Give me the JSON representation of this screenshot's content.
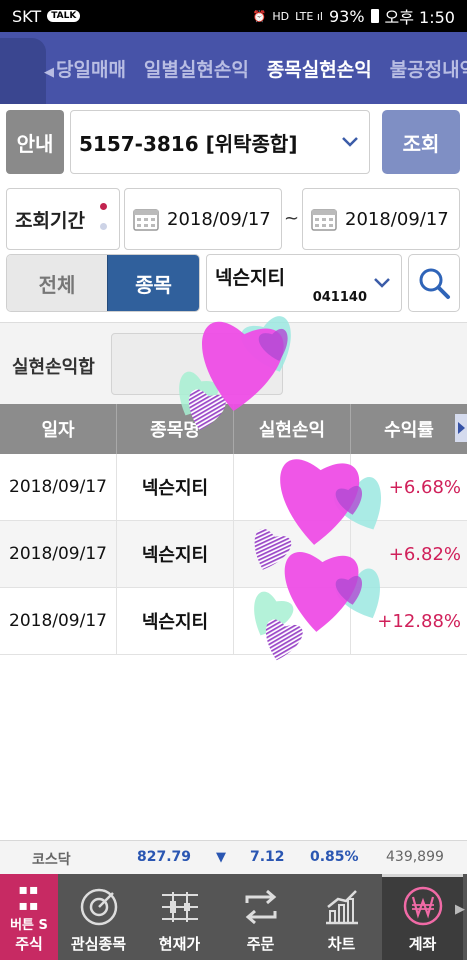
{
  "status_bar": {
    "carrier": "SKT",
    "badge": "TALK",
    "battery": "93%",
    "time": "오후 1:50"
  },
  "tabs": [
    {
      "label": "당일매매"
    },
    {
      "label": "일별실현손익"
    },
    {
      "label": "종목실현손익",
      "active": true
    },
    {
      "label": "불공정내역"
    }
  ],
  "account": {
    "guide_button": "안내",
    "value": "5157-3816 [위탁종합]",
    "query_button": "조회"
  },
  "period": {
    "label": "조회기간",
    "start": "2018/09/17",
    "separator": "~",
    "end": "2018/09/17"
  },
  "filter": {
    "all_label": "전체",
    "item_label": "종목",
    "selected_item": "종목"
  },
  "stock": {
    "name": "넥슨지티",
    "code": "041140"
  },
  "summary": {
    "label": "실현손익합"
  },
  "table": {
    "headers": [
      "일자",
      "종목명",
      "실현손익",
      "수익률"
    ],
    "rows": [
      {
        "date": "2018/09/17",
        "name": "넥슨지티",
        "profit": "",
        "rate": "+6.68%"
      },
      {
        "date": "2018/09/17",
        "name": "넥슨지티",
        "profit": "",
        "rate": "+6.82%"
      },
      {
        "date": "2018/09/17",
        "name": "넥슨지티",
        "profit": "",
        "rate": "+12.88%"
      }
    ]
  },
  "ticker": {
    "name": "코스닥",
    "value": "827.79",
    "direction": "▼",
    "change": "7.12",
    "percent": "0.85%",
    "volume": "439,899"
  },
  "nav": {
    "brand": "버튼 S",
    "items": [
      "주식",
      "관심종목",
      "현재가",
      "주문",
      "차트",
      "계좌"
    ],
    "active": "계좌"
  },
  "colors": {
    "header_bg": "#4753a8",
    "active_segment": "#30609c",
    "profit_positive": "#d0205a",
    "ticker_down": "#2a56b2",
    "nav_brand": "#c72a63"
  }
}
